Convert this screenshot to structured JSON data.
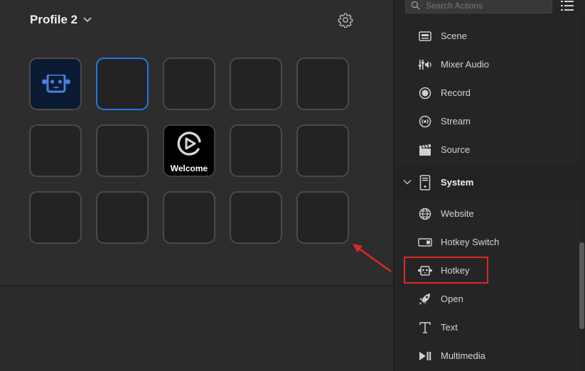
{
  "profile": {
    "name": "Profile 2"
  },
  "search": {
    "placeholder": "Search Actions"
  },
  "keys": {
    "welcome_label": "Welcome"
  },
  "actions": {
    "items_top": [
      {
        "label": "Scene",
        "icon": "scene-icon"
      },
      {
        "label": "Mixer Audio",
        "icon": "mixer-audio-icon"
      },
      {
        "label": "Record",
        "icon": "record-icon"
      },
      {
        "label": "Stream",
        "icon": "stream-icon"
      },
      {
        "label": "Source",
        "icon": "source-icon"
      }
    ],
    "category": {
      "label": "System",
      "icon": "system-icon"
    },
    "items_system": [
      {
        "label": "Website",
        "icon": "globe-icon"
      },
      {
        "label": "Hotkey Switch",
        "icon": "hotkey-switch-icon"
      },
      {
        "label": "Hotkey",
        "icon": "robot-icon"
      },
      {
        "label": "Open",
        "icon": "rocket-icon"
      },
      {
        "label": "Text",
        "icon": "text-icon"
      },
      {
        "label": "Multimedia",
        "icon": "multimedia-icon"
      }
    ]
  },
  "colors": {
    "accent": "#1e7be6",
    "highlight": "#e0282a",
    "robot_icon": "#4a7fe0"
  }
}
